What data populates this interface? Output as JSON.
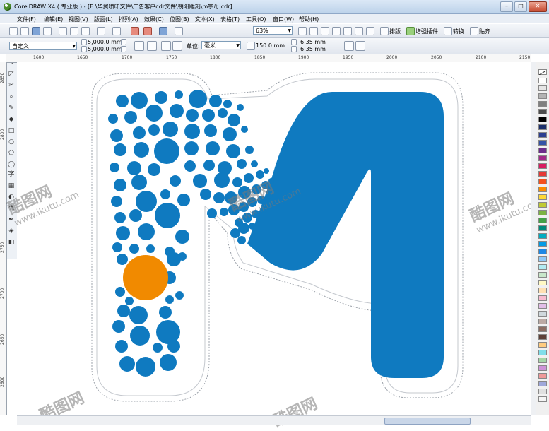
{
  "window": {
    "title": "CorelDRAW X4 ( 专业版 ) - [E:\\华翼喷印文件\\广告客户cdr文件\\朝阳雕刻\\m字母.cdr]",
    "minimize": "–",
    "maximize": "□",
    "close": "✕"
  },
  "menu": [
    "文件(F)",
    "编辑(E)",
    "视图(V)",
    "版面(L)",
    "排列(A)",
    "效果(C)",
    "位图(B)",
    "文本(X)",
    "表格(T)",
    "工具(O)",
    "窗口(W)",
    "帮助(H)"
  ],
  "toolbar": {
    "zoom": "63%",
    "arrange_label": "排版",
    "plugin_label": "增强插件",
    "convert_label": "转换",
    "paste_label": "贴齐"
  },
  "property_bar": {
    "preset": "自定义",
    "width": "5,000.0 mm",
    "height": "5,000.0 mm",
    "units_label": "单位:",
    "units": "毫米",
    "nudge": "150.0 mm",
    "dup_x": "6.35 mm",
    "dup_y": "6.35 mm"
  },
  "ruler": {
    "top": [
      "1600",
      "1650",
      "1700",
      "1750",
      "1800",
      "1850",
      "1900",
      "1950",
      "2000",
      "2050",
      "2100",
      "2150"
    ],
    "left": [
      "2850",
      "2800",
      "2750",
      "2700",
      "2650",
      "2600"
    ]
  },
  "watermark": {
    "brand": "酷图网",
    "url": "www.ikutu.com"
  },
  "artwork": {
    "letter_color": "#0f7ac0",
    "accent_color": "#f18a00",
    "outline_color": "#ffffff"
  },
  "palette_colors": [
    "#ffffff",
    "#e6e6e6",
    "#b3b3b3",
    "#808080",
    "#4d4d4d",
    "#000000",
    "#1b2f6b",
    "#2c3f91",
    "#3453a6",
    "#6c2d8c",
    "#a22a8a",
    "#d81b60",
    "#e53935",
    "#f4511e",
    "#fb8c00",
    "#fdd835",
    "#c0ca33",
    "#7cb342",
    "#43a047",
    "#00897b",
    "#00acc1",
    "#039be5",
    "#1e88e5",
    "#90caf9",
    "#b2ebf2",
    "#c8e6c9",
    "#fff9c4",
    "#ffe0b2",
    "#f8bbd0",
    "#e1bee7",
    "#cfd8dc",
    "#bcaaa4",
    "#8d6e63",
    "#5d4037",
    "#ffcc80",
    "#80deea",
    "#a5d6a7",
    "#ce93d8",
    "#ef9a9a",
    "#9fa8da",
    "#e0e0e0",
    "#f5f5f5"
  ]
}
